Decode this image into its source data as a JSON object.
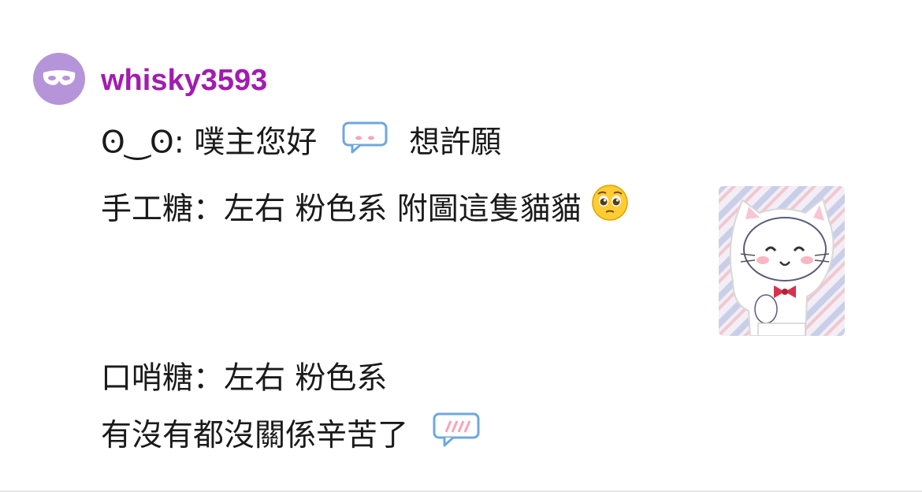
{
  "post": {
    "username": "whisky3593",
    "line1": {
      "prefix": "ʘ‿ʘ: 噗主您好",
      "suffix": "想許願"
    },
    "line2": "手工糖：左右 粉色系 附圖這隻貓貓",
    "line3": "口哨糖：左右 粉色系",
    "line4": "有沒有都沒關係辛苦了"
  },
  "colors": {
    "username": "#a21caf",
    "avatar_bg": "#b594d9"
  },
  "icons": [
    "mask-icon",
    "speech-bubble-blush-icon",
    "pleading-face-emoji",
    "speech-bubble-shy-icon",
    "cat-figure-image"
  ]
}
